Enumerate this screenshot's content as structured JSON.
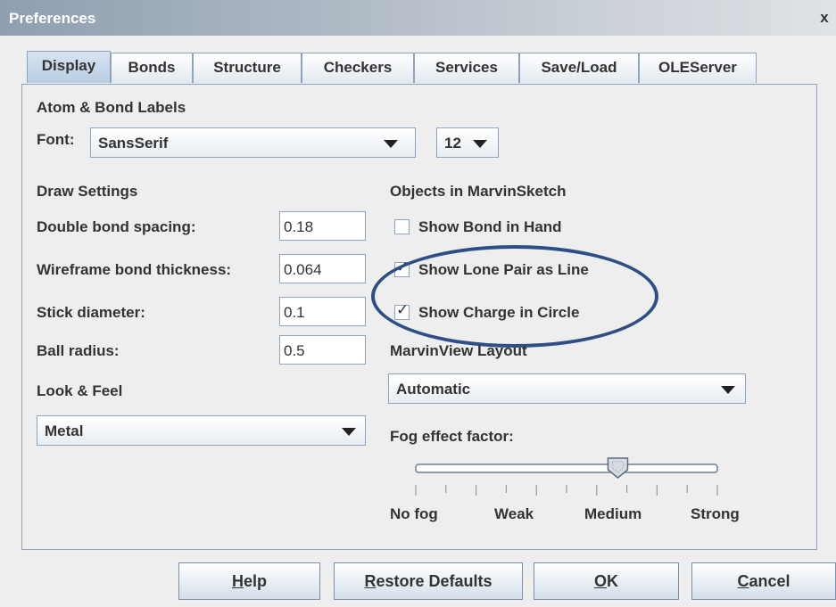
{
  "window": {
    "title": "Preferences",
    "close_glyph": "x"
  },
  "tabs": [
    {
      "label": "Display",
      "active": true
    },
    {
      "label": "Bonds"
    },
    {
      "label": "Structure"
    },
    {
      "label": "Checkers"
    },
    {
      "label": "Services"
    },
    {
      "label": "Save/Load"
    },
    {
      "label": "OLEServer"
    }
  ],
  "atom_bond_labels": {
    "heading": "Atom & Bond Labels",
    "font_label": "Font:",
    "font_value": "SansSerif",
    "size_value": "12"
  },
  "draw_settings": {
    "heading": "Draw Settings",
    "double_bond_spacing": {
      "label": "Double bond spacing:",
      "value": "0.18"
    },
    "wireframe_bond_thickness": {
      "label": "Wireframe bond thickness:",
      "value": "0.064"
    },
    "stick_diameter": {
      "label": "Stick diameter:",
      "value": "0.1"
    },
    "ball_radius": {
      "label": "Ball radius:",
      "value": "0.5"
    }
  },
  "look_feel": {
    "heading": "Look & Feel",
    "value": "Metal"
  },
  "objects": {
    "heading": "Objects in MarvinSketch",
    "show_bond_in_hand": {
      "label": "Show Bond in Hand",
      "checked": false
    },
    "show_lone_pair_as_line": {
      "label": "Show Lone Pair as Line",
      "checked": true
    },
    "show_charge_in_circle": {
      "label": "Show Charge in Circle",
      "checked": true
    }
  },
  "marvinview_layout": {
    "heading": "MarvinView Layout",
    "value": "Automatic"
  },
  "fog": {
    "heading": "Fog effect factor:",
    "level": 0.67,
    "labels": [
      "No fog",
      "Weak",
      "Medium",
      "Strong"
    ]
  },
  "buttons": {
    "help": {
      "accel": "H",
      "rest": "elp"
    },
    "restore": {
      "accel": "R",
      "rest": "estore Defaults"
    },
    "ok": {
      "accel": "O",
      "rest": "K"
    },
    "cancel": {
      "accel": "C",
      "rest": "ancel"
    }
  },
  "colors": {
    "annotation_circle": "#2e4f86",
    "tab_border": "#8ea3bd"
  },
  "icons": [
    "close-icon",
    "dropdown-arrow-icon",
    "checkbox-icon",
    "slider-thumb-icon"
  ]
}
